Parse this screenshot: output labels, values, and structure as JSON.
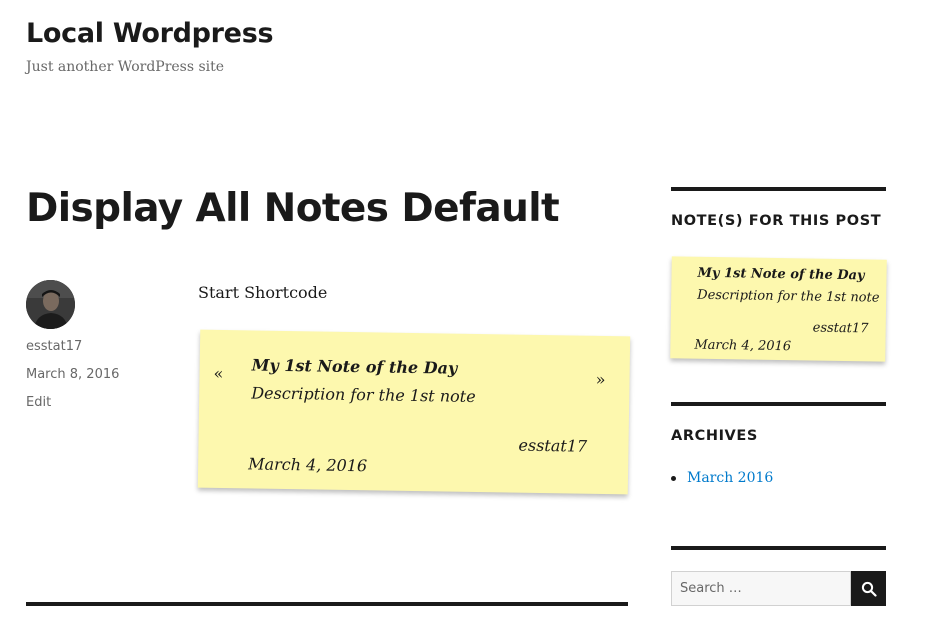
{
  "site": {
    "title": "Local Wordpress",
    "description": "Just another WordPress site"
  },
  "post": {
    "title": "Display All Notes Default",
    "author": "esstat17",
    "date": "March 8, 2016",
    "edit_label": "Edit",
    "content_text": "Start Shortcode"
  },
  "shortcode_note": {
    "prev_label": "«",
    "next_label": "»",
    "title": "My 1st Note of the Day",
    "description": "Description for the 1st note",
    "author": "esstat17",
    "date": "March 4, 2016"
  },
  "sidebar": {
    "notes_widget": {
      "title": "NOTE(S) FOR THIS POST",
      "note": {
        "title": "My 1st Note of the Day",
        "description": "Description for the 1st note",
        "author": "esstat17",
        "date": "March 4, 2016"
      }
    },
    "archives_widget": {
      "title": "ARCHIVES",
      "items": [
        "March 2016"
      ]
    },
    "search": {
      "placeholder": "Search …",
      "button_icon": "search-icon"
    }
  },
  "colors": {
    "note_background": "#fdf8ae",
    "link": "#007acc",
    "text": "#1a1a1a",
    "muted_text": "#686868"
  }
}
